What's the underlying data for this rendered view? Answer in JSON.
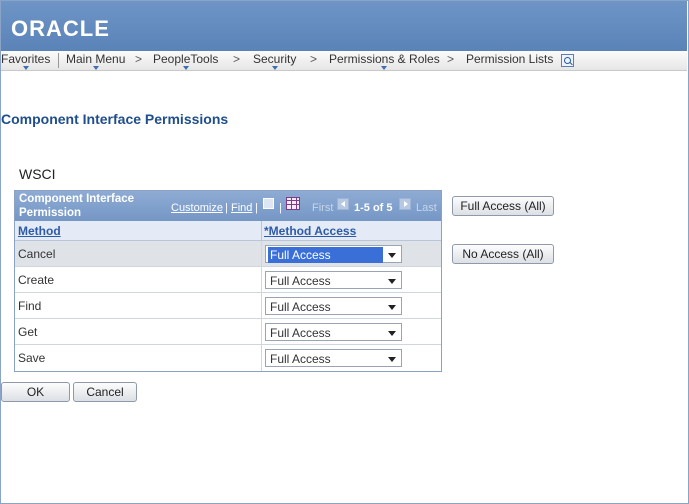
{
  "brand": {
    "logo_text": "ORACLE"
  },
  "nav": {
    "items": [
      "Favorites",
      "Main Menu",
      "PeopleTools",
      "Security",
      "Permissions & Roles",
      "Permission Lists"
    ],
    "separator": ">",
    "search_icon": "search-icon"
  },
  "page": {
    "title": "Component Interface Permissions",
    "ci_name": "WSCI"
  },
  "grid": {
    "title": "Component Interface Permission",
    "customize": "Customize",
    "find": "Find",
    "pipe": "|",
    "pager": {
      "first": "First",
      "range": "1-5 of 5",
      "last": "Last"
    },
    "columns": {
      "method": "Method",
      "access": "*Method Access"
    },
    "rows": [
      {
        "method": "Cancel",
        "access": "Full Access"
      },
      {
        "method": "Create",
        "access": "Full Access"
      },
      {
        "method": "Find",
        "access": "Full Access"
      },
      {
        "method": "Get",
        "access": "Full Access"
      },
      {
        "method": "Save",
        "access": "Full Access"
      }
    ]
  },
  "buttons": {
    "full_access_all": "Full Access (All)",
    "no_access_all": "No Access (All)",
    "ok": "OK",
    "cancel": "Cancel"
  },
  "colors": {
    "brand_bar": "#5a83b8",
    "grid_header": "#7597c6",
    "title_blue": "#1f4e8c",
    "selection": "#3a6fd8"
  }
}
